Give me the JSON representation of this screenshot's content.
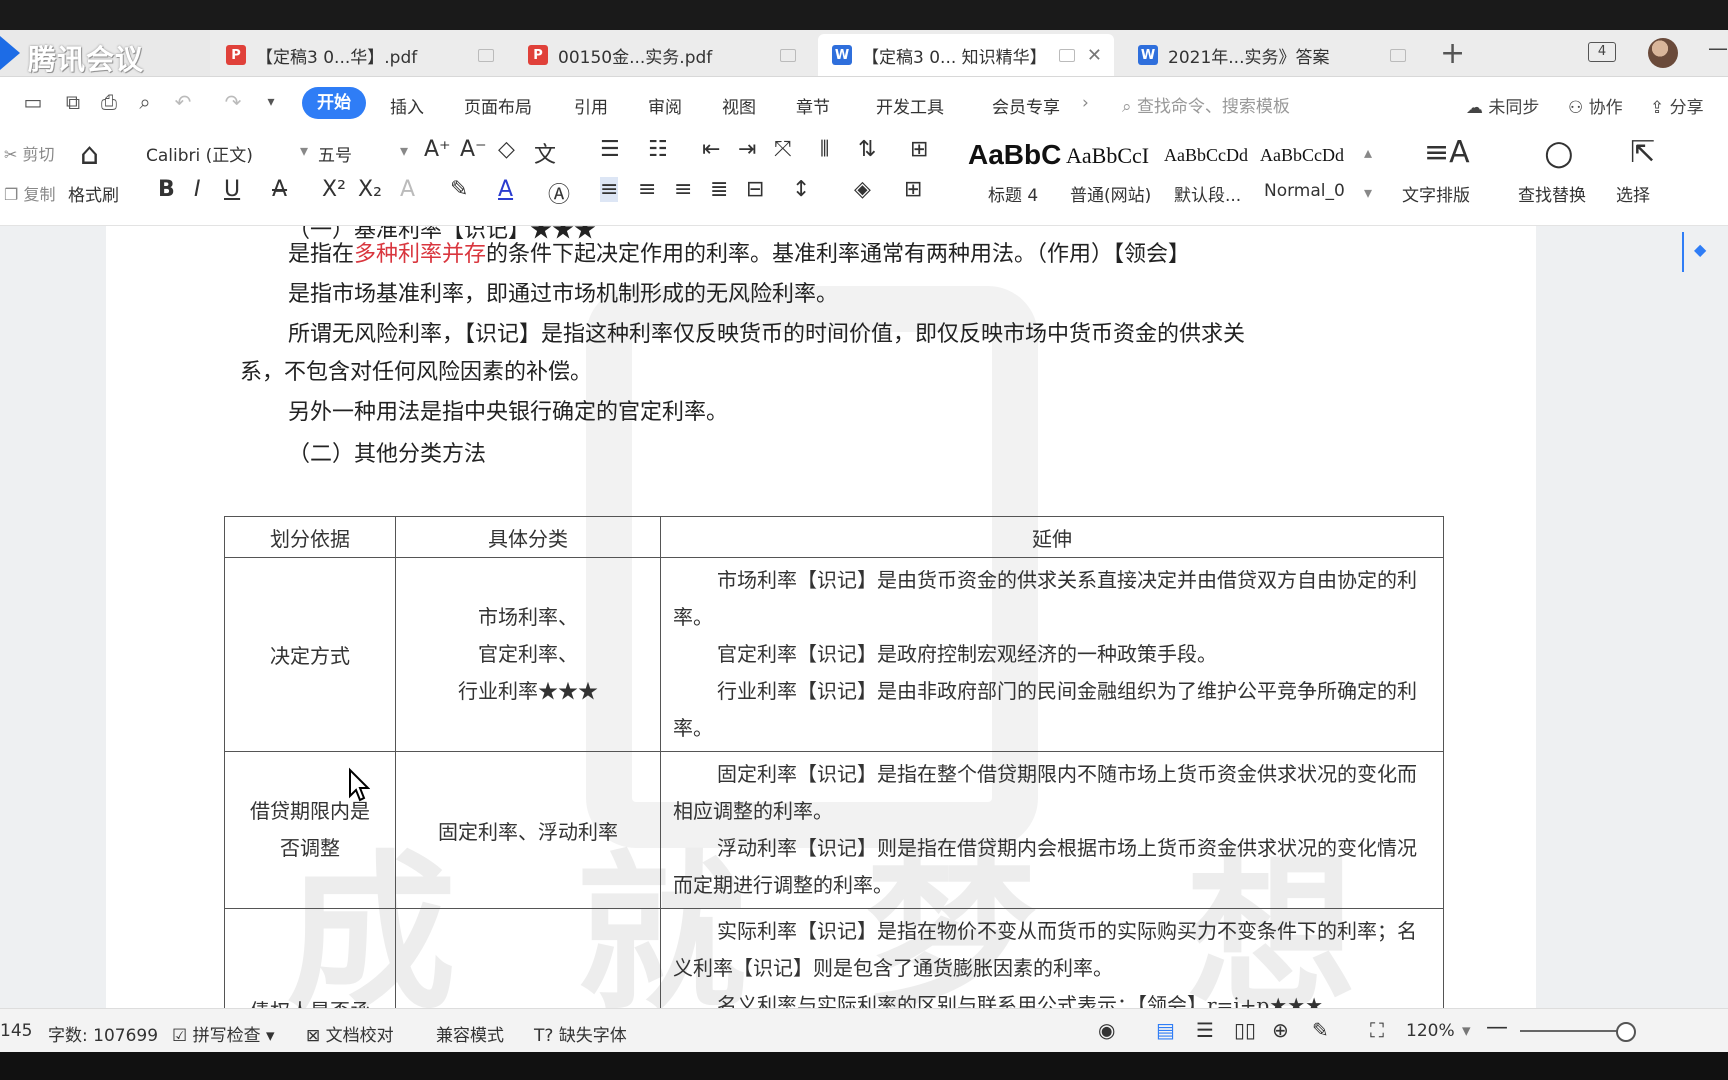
{
  "app": {
    "name": "腾讯会议"
  },
  "tabs": [
    {
      "label": "【定稿3 0...华】.pdf",
      "type": "pdf"
    },
    {
      "label": "00150金...实务.pdf",
      "type": "pdf"
    },
    {
      "label": "【定稿3 0... 知识精华】",
      "type": "doc",
      "active": true
    },
    {
      "label": "2021年...实务》答案",
      "type": "doc"
    }
  ],
  "tabs_count": "4",
  "menu": {
    "active": "开始",
    "items": [
      "插入",
      "页面布局",
      "引用",
      "审阅",
      "视图",
      "章节",
      "开发工具",
      "会员专享"
    ],
    "search_placeholder": "查找命令、搜索模板",
    "sync": "未同步",
    "collab": "协作",
    "share": "分享"
  },
  "ribbon": {
    "cut": "剪切",
    "copy": "复制",
    "format_painter": "格式刷",
    "font_name": "Calibri (正文)",
    "font_size": "五号",
    "styles": [
      {
        "preview": "AaBbC",
        "name": "标题 4"
      },
      {
        "preview": "AaBbCcI",
        "name": "普通(网站)"
      },
      {
        "preview": "AaBbCcDd",
        "name": "默认段..."
      },
      {
        "preview": "AaBbCcDd",
        "name": "Normal_0"
      }
    ],
    "text_layout": "文字排版",
    "find_replace": "查找替换",
    "select": "选择"
  },
  "document": {
    "heading_cut": "（一）基准利率【识记】★★★",
    "line1_pre": "是指在",
    "line1_red": "多种利率并存",
    "line1_post": "的条件下起决定作用的利率。基准利率通常有两种用法。（作用）【领会】",
    "line2": "是指市场基准利率，即通过市场机制形成的无风险利率。",
    "line3": "所谓无风险利率，【识记】是指这种利率仅反映货币的时间价值，即仅反映市场中货币资金的供求关",
    "line4": "系，不包含对任何风险因素的补偿。",
    "line5": "另外一种用法是指中央银行确定的官定利率。",
    "section2": "（二）其他分类方法",
    "table": {
      "headers": [
        "划分依据",
        "具体分类",
        "延伸"
      ],
      "rows": [
        {
          "basis": "决定方式",
          "category": [
            "市场利率、",
            "官定利率、",
            "行业利率★★★"
          ],
          "ext": [
            "市场利率【识记】是由货币资金的供求关系直接决定并由借贷双方自由协定的利率。",
            "官定利率【识记】是政府控制宏观经济的一种政策手段。",
            "行业利率【识记】是由非政府部门的民间金融组织为了维护公平竞争所确定的利率。"
          ]
        },
        {
          "basis": [
            "借贷期限内是",
            "否调整"
          ],
          "category": [
            "固定利率、浮动利率"
          ],
          "ext": [
            "固定利率【识记】是指在整个借贷期限内不随市场上货币资金供求状况的变化而相应调整的利率。",
            "浮动利率【识记】则是指在借贷期内会根据市场上货币资金供求状况的变化情况而定期进行调整的利率。"
          ]
        },
        {
          "basis": "债权人是否承",
          "category": [
            ""
          ],
          "ext": [
            "实际利率【识记】是指在物价不变从而货币的实际购买力不变条件下的利率；名义利率【识记】则是包含了通货膨胀因素的利率。",
            "名义利率与实际利率的区别与联系用公式表示：【领会】r=i+p★★★"
          ]
        }
      ]
    }
  },
  "status": {
    "page": "145",
    "word_count": "字数: 107699",
    "spell_check": "拼写检查",
    "doc_proof": "文档校对",
    "compat": "兼容模式",
    "missing_font": "缺失字体",
    "zoom": "120%"
  }
}
